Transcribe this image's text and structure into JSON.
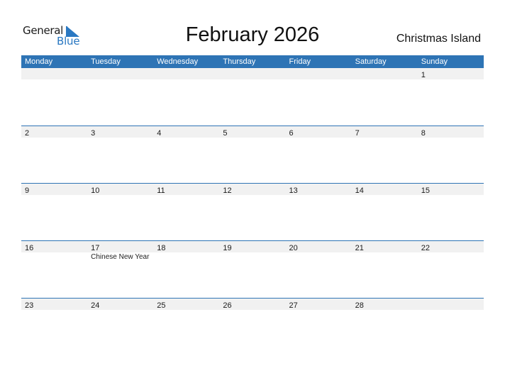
{
  "logo": {
    "word1": "General",
    "word2": "Blue"
  },
  "title": "February 2026",
  "region": "Christmas Island",
  "colors": {
    "accent": "#2e74b5",
    "strip": "#f1f1f1",
    "logo_blue": "#2a78c2"
  },
  "weekdays": [
    "Monday",
    "Tuesday",
    "Wednesday",
    "Thursday",
    "Friday",
    "Saturday",
    "Sunday"
  ],
  "weeks": [
    {
      "days": [
        "",
        "",
        "",
        "",
        "",
        "",
        "1"
      ],
      "events": [
        "",
        "",
        "",
        "",
        "",
        "",
        ""
      ]
    },
    {
      "days": [
        "2",
        "3",
        "4",
        "5",
        "6",
        "7",
        "8"
      ],
      "events": [
        "",
        "",
        "",
        "",
        "",
        "",
        ""
      ]
    },
    {
      "days": [
        "9",
        "10",
        "11",
        "12",
        "13",
        "14",
        "15"
      ],
      "events": [
        "",
        "",
        "",
        "",
        "",
        "",
        ""
      ]
    },
    {
      "days": [
        "16",
        "17",
        "18",
        "19",
        "20",
        "21",
        "22"
      ],
      "events": [
        "",
        "Chinese New Year",
        "",
        "",
        "",
        "",
        ""
      ]
    },
    {
      "days": [
        "23",
        "24",
        "25",
        "26",
        "27",
        "28",
        ""
      ],
      "events": [
        "",
        "",
        "",
        "",
        "",
        "",
        ""
      ]
    }
  ]
}
